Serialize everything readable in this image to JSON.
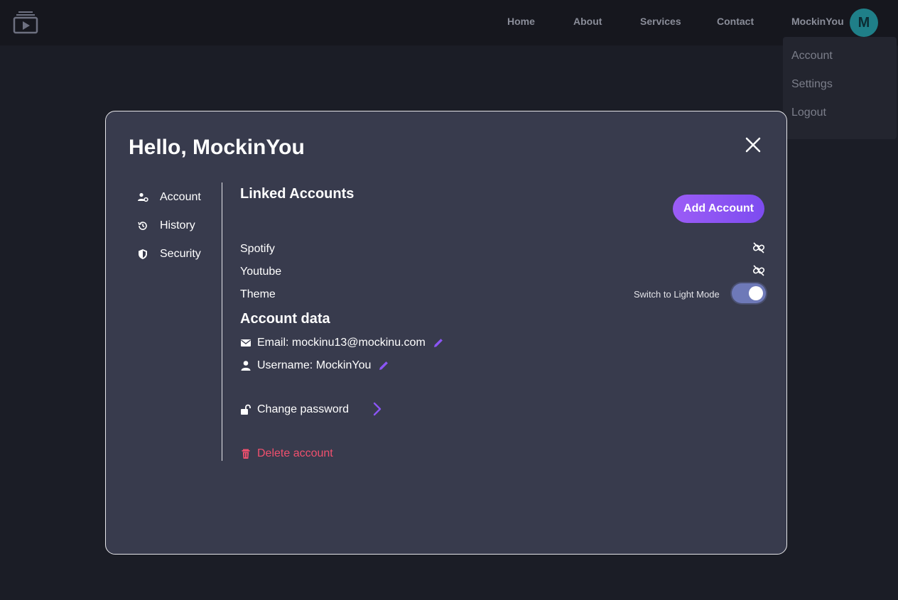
{
  "nav": {
    "links": [
      "Home",
      "About",
      "Services",
      "Contact"
    ],
    "username": "MockinYou",
    "avatar_initial": "M"
  },
  "dropdown": {
    "items": [
      "Account",
      "Settings",
      "Logout"
    ]
  },
  "modal": {
    "title": "Hello, MockinYou",
    "sidebar": [
      {
        "label": "Account",
        "icon": "user-gear-icon"
      },
      {
        "label": "History",
        "icon": "history-icon"
      },
      {
        "label": "Security",
        "icon": "shield-icon"
      }
    ],
    "linked": {
      "title": "Linked Accounts",
      "add_label": "Add Account",
      "accounts": [
        "Spotify",
        "Youtube"
      ]
    },
    "theme": {
      "label": "Theme",
      "switch_label": "Switch to Light Mode",
      "dark_mode_on": true
    },
    "account_data": {
      "title": "Account data",
      "email": "Email: mockinu13@mockinu.com",
      "username": "Username: MockinYou",
      "change_password": "Change password",
      "delete": "Delete account"
    }
  },
  "colors": {
    "accent": "#8b55f5",
    "danger": "#f0506e",
    "modal_bg": "#383b4d",
    "page_bg": "#1b1d26"
  }
}
